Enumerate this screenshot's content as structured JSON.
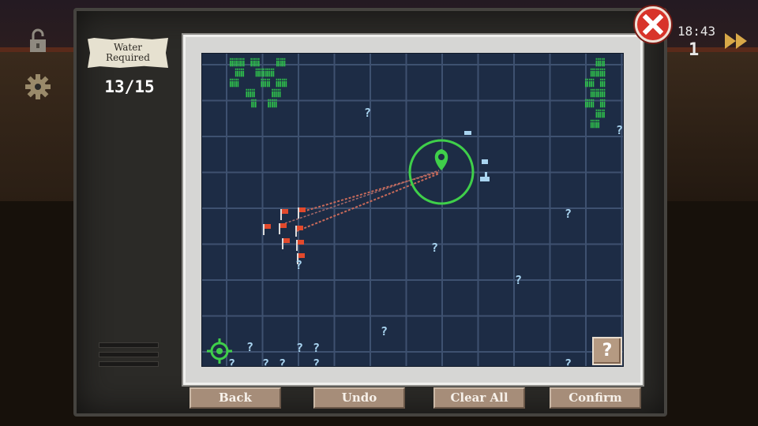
{
  "hud": {
    "water_label_line1": "Water",
    "water_label_line2": "Required",
    "water_count": "13/15",
    "time": "18:43",
    "day": "1",
    "icons": [
      "lock-icon",
      "gear-icon",
      "close-icon",
      "fast-forward-icon",
      "locate-icon"
    ]
  },
  "map": {
    "help_label": "?",
    "unknown_marker": "?"
  },
  "buttons": {
    "back": "Back",
    "undo": "Undo",
    "clear_all": "Clear All",
    "confirm": "Confirm"
  },
  "colors": {
    "map_bg": "#1d2c45",
    "grid": "#3e5170",
    "target_green": "#3fcf4a",
    "flag_red": "#e2492c",
    "button": "#a68d79",
    "close_red": "#d8342a"
  }
}
